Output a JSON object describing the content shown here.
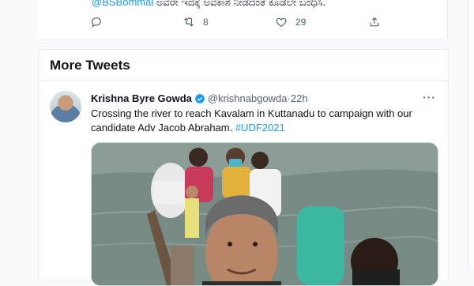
{
  "previous_tweet": {
    "mention": "@BSBommai",
    "text": " ಅವರೇ ಇದಕ್ಕೆ ಅವಕಾಶ ನೀಡದಂತೆ ಕೂಡಲೇ ಬಂಧಿಸಿ.",
    "retweet_count": "8",
    "like_count": "29"
  },
  "section": {
    "title": "More Tweets"
  },
  "tweet": {
    "author_name": "Krishna Byre Gowda",
    "handle": "@krishnabgowda",
    "separator": " · ",
    "time": "22h",
    "more": "···",
    "text": "Crossing the river to reach Kavalam in Kuttanadu to campaign with our candidate Adv Jacob Abraham. ",
    "hashtag": "#UDF2021"
  },
  "colors": {
    "accent": "#1d9bf0",
    "text": "#0f1419",
    "muted": "#536471",
    "background": "#f7f9fa"
  },
  "icons": [
    "reply-icon",
    "retweet-icon",
    "like-icon",
    "share-icon",
    "verified-badge-icon",
    "more-options-icon"
  ]
}
